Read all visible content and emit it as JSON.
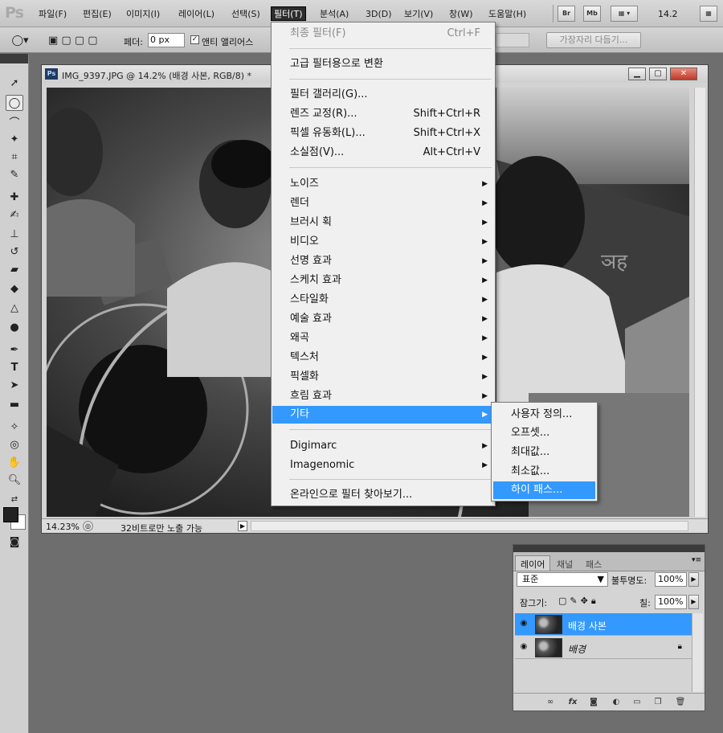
{
  "menubar": {
    "logo": "Ps",
    "items": [
      {
        "label": "파일(F)"
      },
      {
        "label": "편집(E)"
      },
      {
        "label": "이미지(I)"
      },
      {
        "label": "레이어(L)"
      },
      {
        "label": "선택(S)"
      },
      {
        "label": "필터(T)"
      },
      {
        "label": "분석(A)"
      },
      {
        "label": "3D(D)"
      },
      {
        "label": "보기(V)"
      },
      {
        "label": "창(W)"
      },
      {
        "label": "도움말(H)"
      }
    ],
    "bridge": "Br",
    "minibridge": "Mb",
    "zoom": "14.2"
  },
  "options": {
    "feather_label": "페더:",
    "feather_value": "0 px",
    "antialias_label": "앤티 앨리어스",
    "refine_button": "가장자리 다듬기..."
  },
  "document": {
    "title": "IMG_9397.JPG @ 14.2% (배경 사본, RGB/8) *",
    "zoom_pct": "14.23%",
    "status": "32비트로만 노출 가능"
  },
  "filter_menu": {
    "last_filter": {
      "label": "최종 필터(F)",
      "shortcut": "Ctrl+F"
    },
    "smart": "고급 필터용으로 변환",
    "group1": [
      {
        "label": "필터 갤러리(G)...",
        "shortcut": ""
      },
      {
        "label": "렌즈 교정(R)...",
        "shortcut": "Shift+Ctrl+R"
      },
      {
        "label": "픽셀 유동화(L)...",
        "shortcut": "Shift+Ctrl+X"
      },
      {
        "label": "소실점(V)...",
        "shortcut": "Alt+Ctrl+V"
      }
    ],
    "submenus": [
      {
        "label": "노이즈"
      },
      {
        "label": "렌더"
      },
      {
        "label": "브러시 획"
      },
      {
        "label": "비디오"
      },
      {
        "label": "선명 효과"
      },
      {
        "label": "스케치 효과"
      },
      {
        "label": "스타일화"
      },
      {
        "label": "예술 효과"
      },
      {
        "label": "왜곡"
      },
      {
        "label": "텍스처"
      },
      {
        "label": "픽셀화"
      },
      {
        "label": "흐림 효과"
      },
      {
        "label": "기타"
      }
    ],
    "plugins": [
      {
        "label": "Digimarc"
      },
      {
        "label": "Imagenomic"
      }
    ],
    "browse": "온라인으로 필터 찾아보기..."
  },
  "other_submenu": {
    "items": [
      {
        "label": "사용자 정의..."
      },
      {
        "label": "오프셋..."
      },
      {
        "label": "최대값..."
      },
      {
        "label": "최소값..."
      },
      {
        "label": "하이 패스..."
      }
    ]
  },
  "layers_panel": {
    "tabs": [
      {
        "label": "레이어"
      },
      {
        "label": "채널"
      },
      {
        "label": "패스"
      }
    ],
    "blend_mode": "표준",
    "opacity_label": "불투명도:",
    "opacity": "100%",
    "lock_label": "잠그기:",
    "fill_label": "칠:",
    "fill": "100%",
    "layers": [
      {
        "name": "배경 사본"
      },
      {
        "name": "배경"
      }
    ],
    "bottom_icons": [
      "link-icon",
      "fx-icon",
      "mask-icon",
      "adjustment-icon",
      "group-icon",
      "new-layer-icon",
      "trash-icon"
    ]
  },
  "colors": {
    "highlight": "#3399ff",
    "workspace": "#6e6e6e"
  }
}
